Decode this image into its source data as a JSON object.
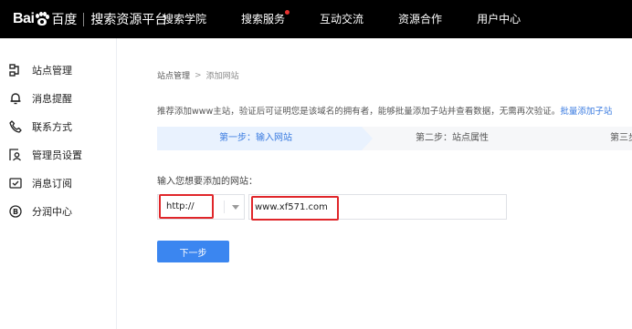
{
  "header": {
    "logo_bai": "Bai",
    "logo_cn": "百度",
    "product": "搜索资源平台",
    "nav": [
      {
        "label": "搜索学院",
        "dot": false
      },
      {
        "label": "搜索服务",
        "dot": true
      },
      {
        "label": "互动交流",
        "dot": false
      },
      {
        "label": "资源合作",
        "dot": false
      },
      {
        "label": "用户中心",
        "dot": false
      }
    ]
  },
  "sidebar": {
    "items": [
      {
        "label": "站点管理",
        "icon": "sitemap-icon"
      },
      {
        "label": "消息提醒",
        "icon": "bell-icon"
      },
      {
        "label": "联系方式",
        "icon": "phone-icon"
      },
      {
        "label": "管理员设置",
        "icon": "admin-user-icon"
      },
      {
        "label": "消息订阅",
        "icon": "subscribe-icon"
      },
      {
        "label": "分润中心",
        "icon": "coin-b-icon"
      }
    ]
  },
  "breadcrumb": {
    "parent": "站点管理",
    "separator": ">",
    "current": "添加网站"
  },
  "notice": {
    "text": "推荐添加www主站，验证后可证明您是该域名的拥有者，能够批量添加子站并查看数据，无需再次验证。",
    "link": "批量添加子站"
  },
  "steps": {
    "step1": "第一步：输入网站",
    "step2": "第二步：站点属性",
    "step3": "第三步"
  },
  "form": {
    "label": "输入您想要添加的网站：",
    "protocol": "http://",
    "url_value": "www.xf571.com",
    "submit": "下一步"
  },
  "colors": {
    "accent": "#3b86f0",
    "highlight": "#e0262a",
    "nav_bg": "#000000",
    "step_active_bg": "#e9f2fe"
  }
}
